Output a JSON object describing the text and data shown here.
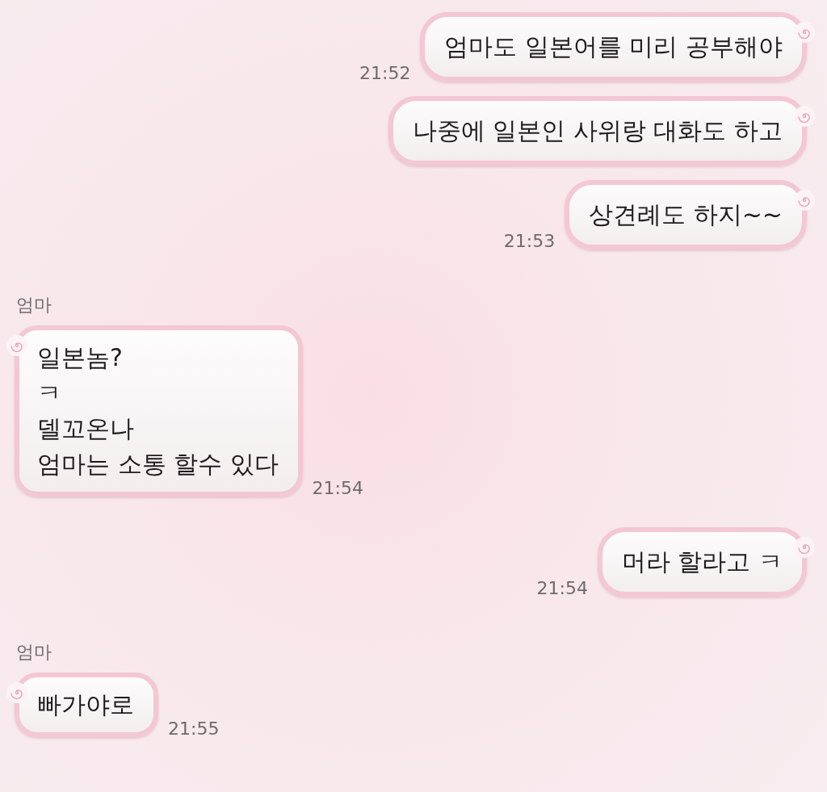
{
  "messages": [
    {
      "kind": "sent",
      "text": "엄마도 일본어를 미리 공부해야",
      "time": "21:52"
    },
    {
      "kind": "sent",
      "text": "나중에 일본인 사위랑 대화도 하고"
    },
    {
      "kind": "sent",
      "text": "상견례도 하지~~",
      "time": "21:53"
    },
    {
      "kind": "received",
      "sender": "엄마",
      "text": "일본놈?\nㅋ\n델꼬온나\n엄마는 소통 할수 있다",
      "time": "21:54"
    },
    {
      "kind": "sent",
      "text": "머라 할라고 ㅋ",
      "time": "21:54"
    },
    {
      "kind": "received",
      "sender": "엄마",
      "text": "빠가야로",
      "time": "21:55"
    }
  ]
}
